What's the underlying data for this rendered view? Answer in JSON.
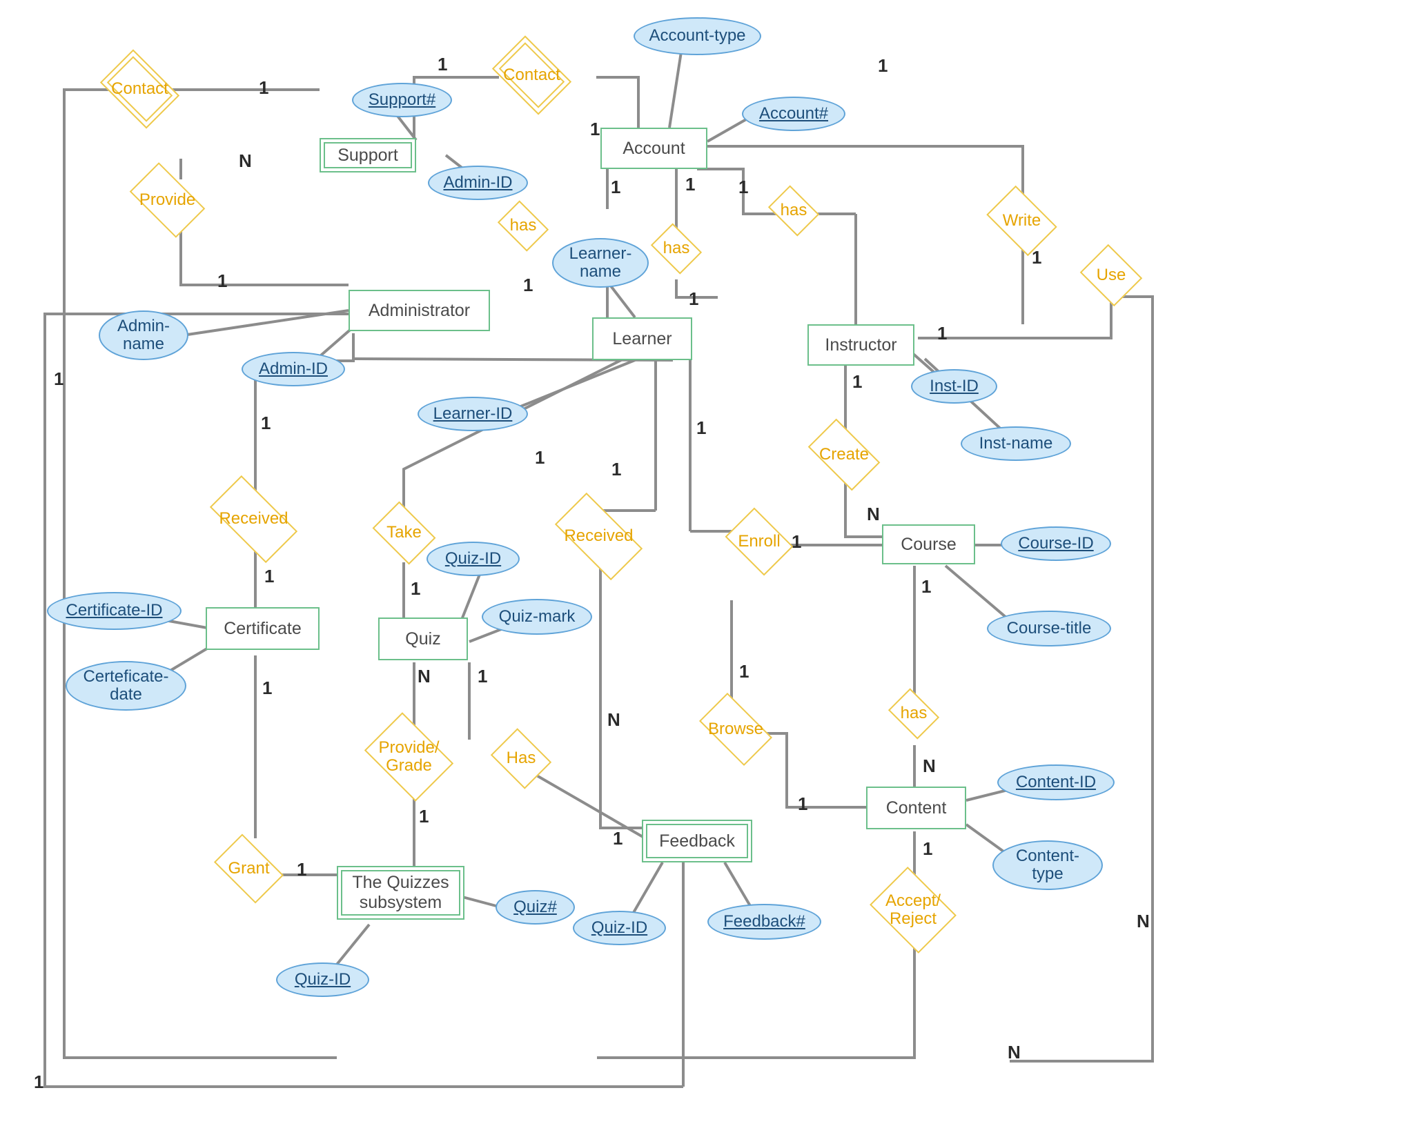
{
  "entities": {
    "support": "Support",
    "account": "Account",
    "administrator": "Administrator",
    "learner": "Learner",
    "instructor": "Instructor",
    "certificate": "Certificate",
    "quiz": "Quiz",
    "course": "Course",
    "content": "Content",
    "quizzes_subsystem": "The Quizzes subsystem",
    "feedback": "Feedback"
  },
  "relations": {
    "contact_admin": "Contact",
    "contact_acct": "Contact",
    "provide": "Provide",
    "write": "Write",
    "use": "Use",
    "has_acct_learner": "has",
    "has_acct_instructor": "has",
    "has_learner_acct": "has",
    "create": "Create",
    "received_cert": "Received",
    "take": "Take",
    "received_fb": "Received",
    "enroll": "Enroll",
    "browse": "Browse",
    "has_course_content": "has",
    "has_quiz_fb": "Has",
    "provide_grade": "Provide/\nGrade",
    "grant": "Grant",
    "accept_reject": "Accept/\nReject"
  },
  "attributes": {
    "support_no": "Support#",
    "admin_id_sup": "Admin-ID",
    "account_type": "Account-type",
    "account_no": "Account#",
    "admin_name": "Admin-\nname",
    "admin_id": "Admin-ID",
    "learner_name": "Learner-\nname",
    "learner_id": "Learner-ID",
    "inst_id": "Inst-ID",
    "inst_name": "Inst-name",
    "certificate_id": "Certificate-ID",
    "certificate_date": "Certeficate-\ndate",
    "quiz_id": "Quiz-ID",
    "quiz_mark": "Quiz-mark",
    "course_id": "Course-ID",
    "course_title": "Course-title",
    "content_id": "Content-ID",
    "content_type": "Content-\ntype",
    "quiz_no": "Quiz#",
    "quiz_id_sub": "Quiz-ID",
    "quiz_id_fb": "Quiz-ID",
    "feedback_no": "Feedback#"
  },
  "card": {
    "c1": "1",
    "c2": "1",
    "c3": "1",
    "c4": "N",
    "c5": "1",
    "c6": "1",
    "c7": "1",
    "c8": "1",
    "c9": "1",
    "c10": "1",
    "c11": "1",
    "c12": "1",
    "c13": "1",
    "c14": "1",
    "c15": "1",
    "c16": "1",
    "c17": "1",
    "c18": "1",
    "c19": "1",
    "c20": "1",
    "c21": "N",
    "c22": "N",
    "c23": "1",
    "c24": "N",
    "c25": "N",
    "c26": "1",
    "c27": "1",
    "c28": "1",
    "c29": "1",
    "c30": "1",
    "c31": "1",
    "c32": "1",
    "c33": "N",
    "c34": "1",
    "c35": "N",
    "c36": "1"
  }
}
